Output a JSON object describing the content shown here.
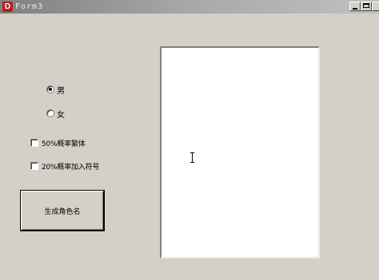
{
  "window": {
    "title": "Form3",
    "icon_letter": "D"
  },
  "gender": {
    "options": [
      {
        "label": "男",
        "selected": true
      },
      {
        "label": "女",
        "selected": false
      }
    ]
  },
  "options": {
    "traditional_label": "50%概率繁体",
    "traditional_checked": false,
    "symbol_label": "20%概率加入符号",
    "symbol_checked": false
  },
  "actions": {
    "generate_label": "生成角色名"
  },
  "output": {
    "text": ""
  },
  "icons": {
    "app": "delphi-app-icon",
    "cursor": "text-cursor-icon"
  }
}
